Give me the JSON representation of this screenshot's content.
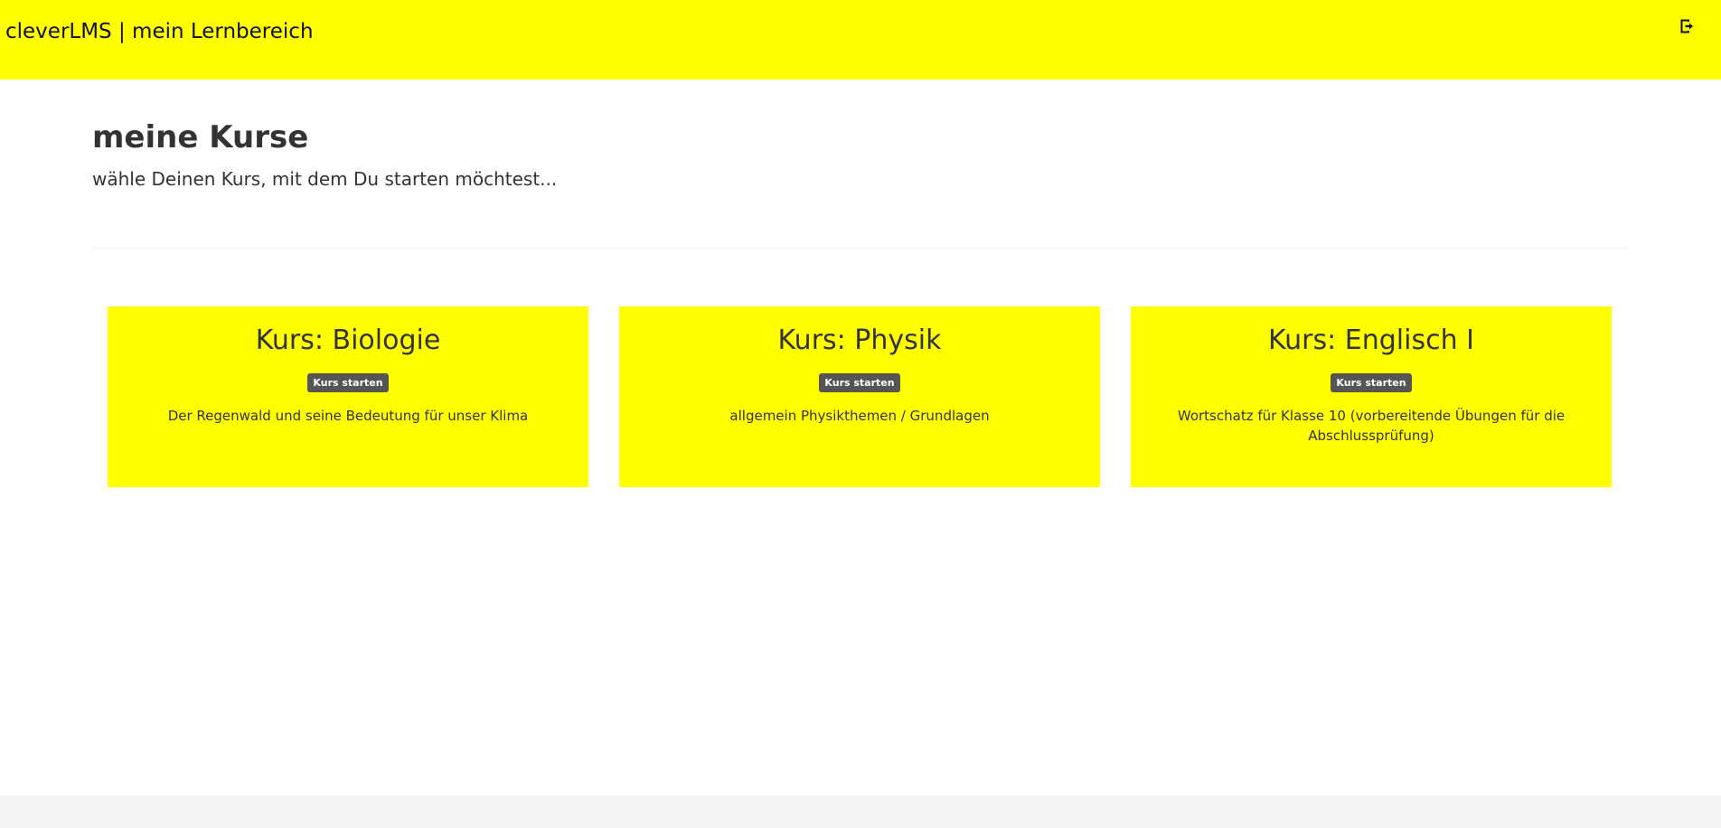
{
  "header": {
    "brand": "cleverLMS | mein Lernbereich",
    "logout_icon": "sign-out-icon"
  },
  "main": {
    "title": "meine Kurse",
    "subtitle": "wähle Deinen Kurs, mit dem Du starten möchtest..."
  },
  "courses": [
    {
      "title": "Kurs: Biologie",
      "button_label": "Kurs starten",
      "description": "Der Regenwald und seine Bedeutung für unser Klima"
    },
    {
      "title": "Kurs: Physik",
      "button_label": "Kurs starten",
      "description": "allgemein Physikthemen / Grundlagen"
    },
    {
      "title": "Kurs: Englisch I",
      "button_label": "Kurs starten",
      "description": "Wortschatz für Klasse 10 (vorbereitende Übungen für die Abschlussprüfung)"
    }
  ],
  "colors": {
    "accent": "#ffff00",
    "button": "#555555",
    "text": "#333333",
    "footer": "#f4f4f4"
  }
}
